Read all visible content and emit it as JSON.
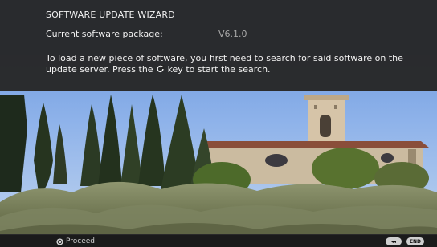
{
  "wizard": {
    "title": "SOFTWARE UPDATE WIZARD",
    "package_label": "Current software package:",
    "package_version": "V6.1.0",
    "instruction_part1": "To load a new piece of software, you first need to search for said software on the update server. Press the",
    "instruction_key_icon": "ok-key-icon",
    "instruction_part2": "key to start the search."
  },
  "footer": {
    "proceed_label": "Proceed",
    "proceed_icon": "ok-key-icon",
    "back_key_label": "◂◂",
    "end_key_label": "END"
  },
  "colors": {
    "panel_bg": "#262626",
    "text_primary": "#f2f2f2",
    "text_secondary": "#a9a9a9",
    "key_pill_bg": "#cfcfcf"
  }
}
